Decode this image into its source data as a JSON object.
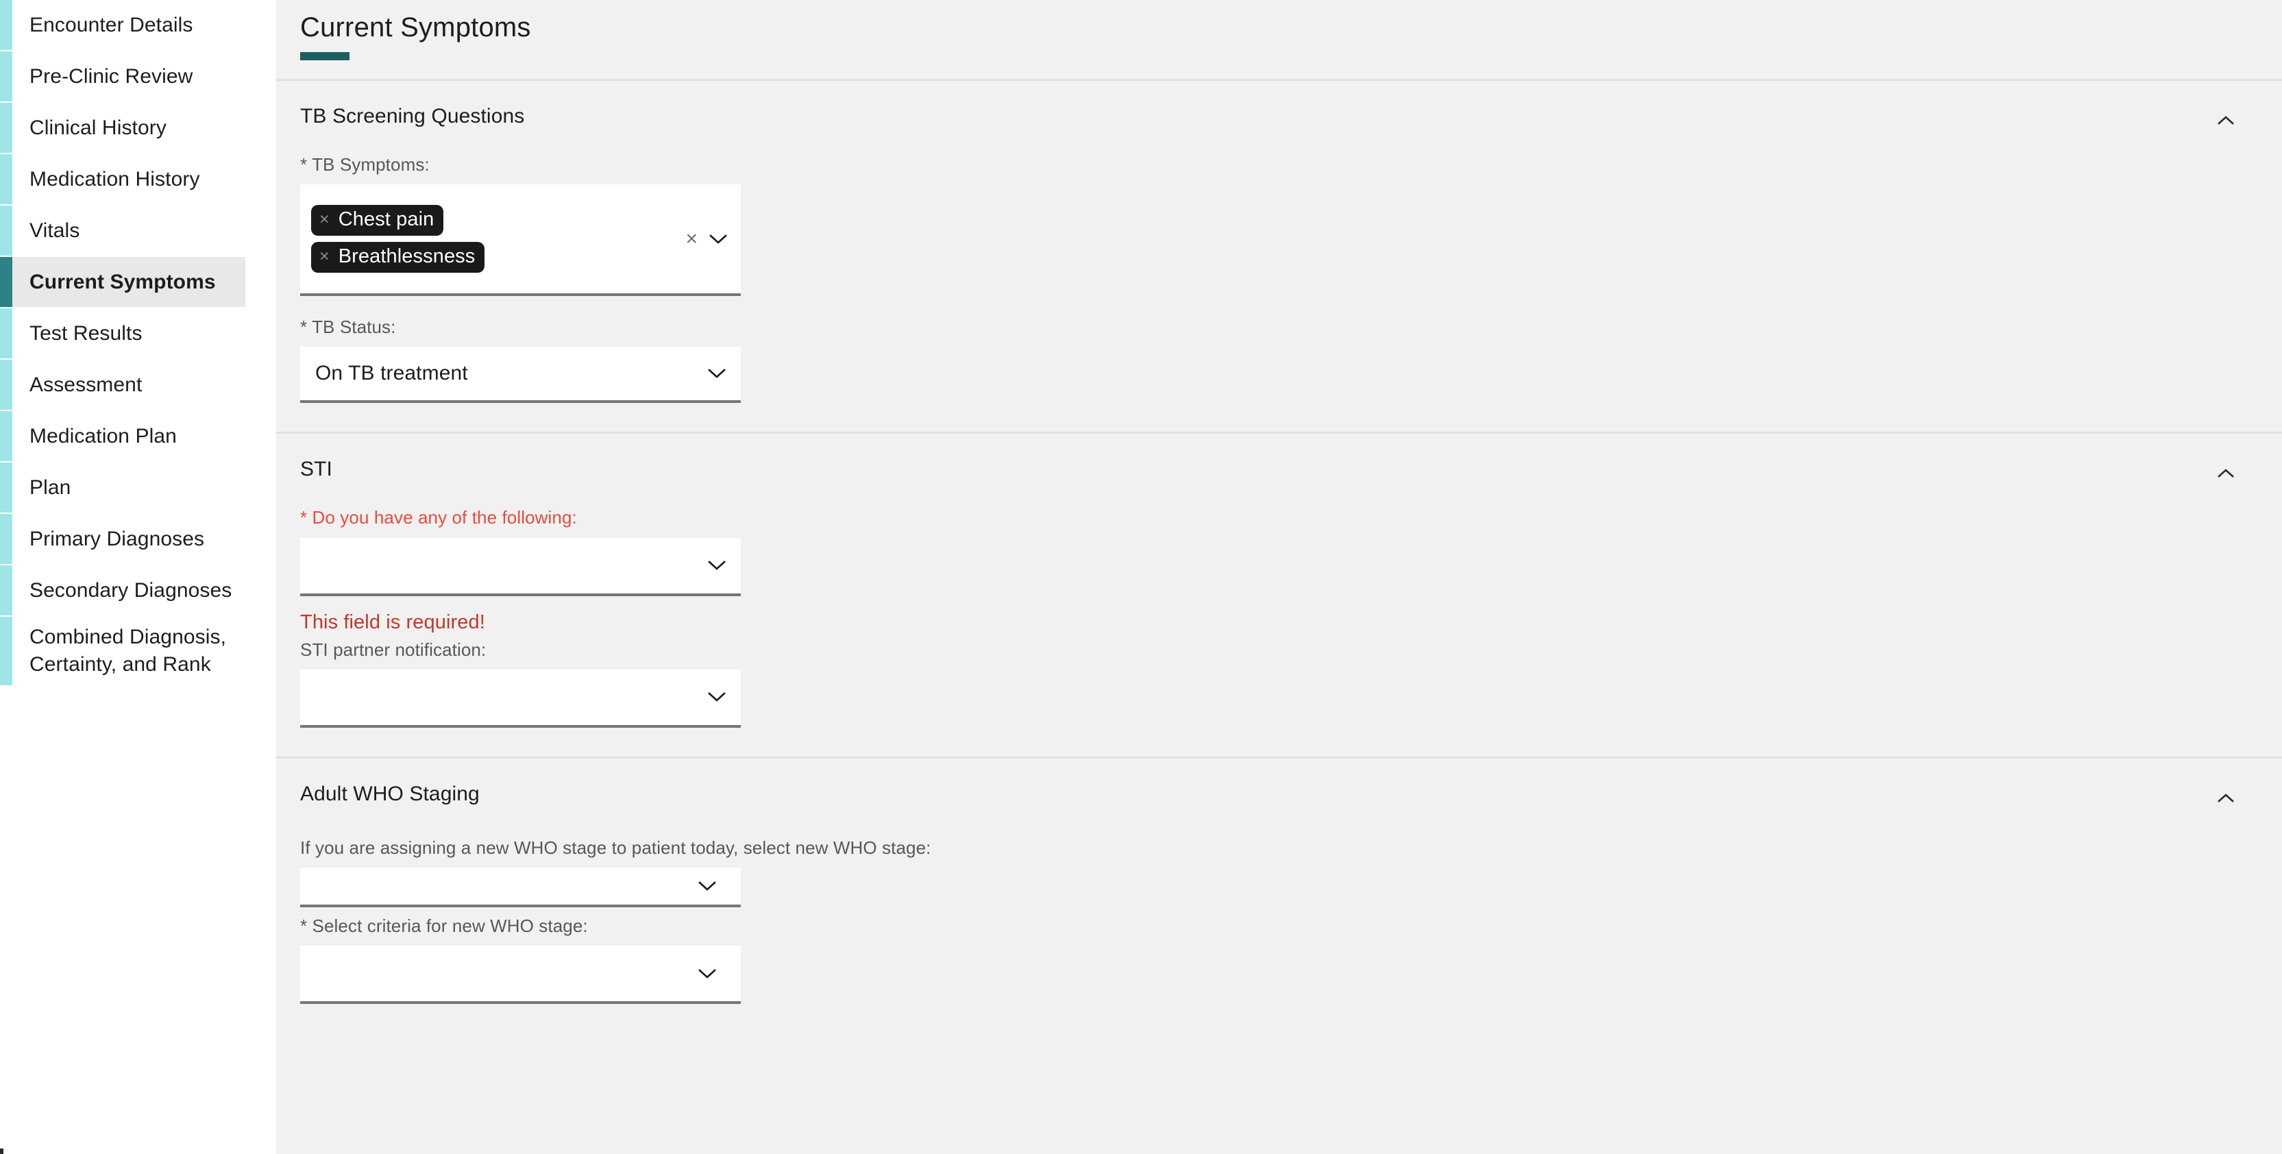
{
  "sidebar": {
    "items": [
      {
        "label": "Encounter Details",
        "active": false
      },
      {
        "label": "Pre-Clinic Review",
        "active": false
      },
      {
        "label": "Clinical History",
        "active": false
      },
      {
        "label": "Medication History",
        "active": false
      },
      {
        "label": "Vitals",
        "active": false
      },
      {
        "label": "Current Symptoms",
        "active": true
      },
      {
        "label": "Test Results",
        "active": false
      },
      {
        "label": "Assessment",
        "active": false
      },
      {
        "label": "Medication Plan",
        "active": false
      },
      {
        "label": "Plan",
        "active": false
      },
      {
        "label": "Primary Diagnoses",
        "active": false
      },
      {
        "label": "Secondary Diagnoses",
        "active": false
      },
      {
        "label": "Combined Diagnosis, Certainty, and Rank",
        "active": false
      }
    ]
  },
  "header": {
    "title": "Current Symptoms",
    "accent_color": "#1e5e60"
  },
  "sections": {
    "tb": {
      "title": "TB Screening Questions",
      "collapse_icon": "chevron-up-icon",
      "symptoms": {
        "label": "* TB Symptoms:",
        "chips": [
          "Chest pain",
          "Breathlessness"
        ],
        "remove_icon": "close-icon",
        "clear_icon": "close-icon",
        "dropdown_icon": "chevron-down-icon"
      },
      "status": {
        "label": "* TB Status:",
        "value": "On TB treatment",
        "dropdown_icon": "chevron-down-icon"
      }
    },
    "sti": {
      "title": "STI",
      "collapse_icon": "chevron-up-icon",
      "following": {
        "label": "* Do you have any of the following:",
        "value": "",
        "error": "This field is required!",
        "dropdown_icon": "chevron-down-icon"
      },
      "partner": {
        "label": "STI partner notification:",
        "value": "",
        "dropdown_icon": "chevron-down-icon"
      }
    },
    "who": {
      "title": "Adult WHO Staging",
      "collapse_icon": "chevron-up-icon",
      "new_stage": {
        "label": "If you are assigning a new WHO stage to patient today, select new WHO stage:",
        "value": "",
        "dropdown_icon": "chevron-down-icon"
      },
      "criteria": {
        "label": "* Select criteria for new WHO stage:",
        "value": "",
        "dropdown_icon": "chevron-down-icon"
      }
    }
  }
}
